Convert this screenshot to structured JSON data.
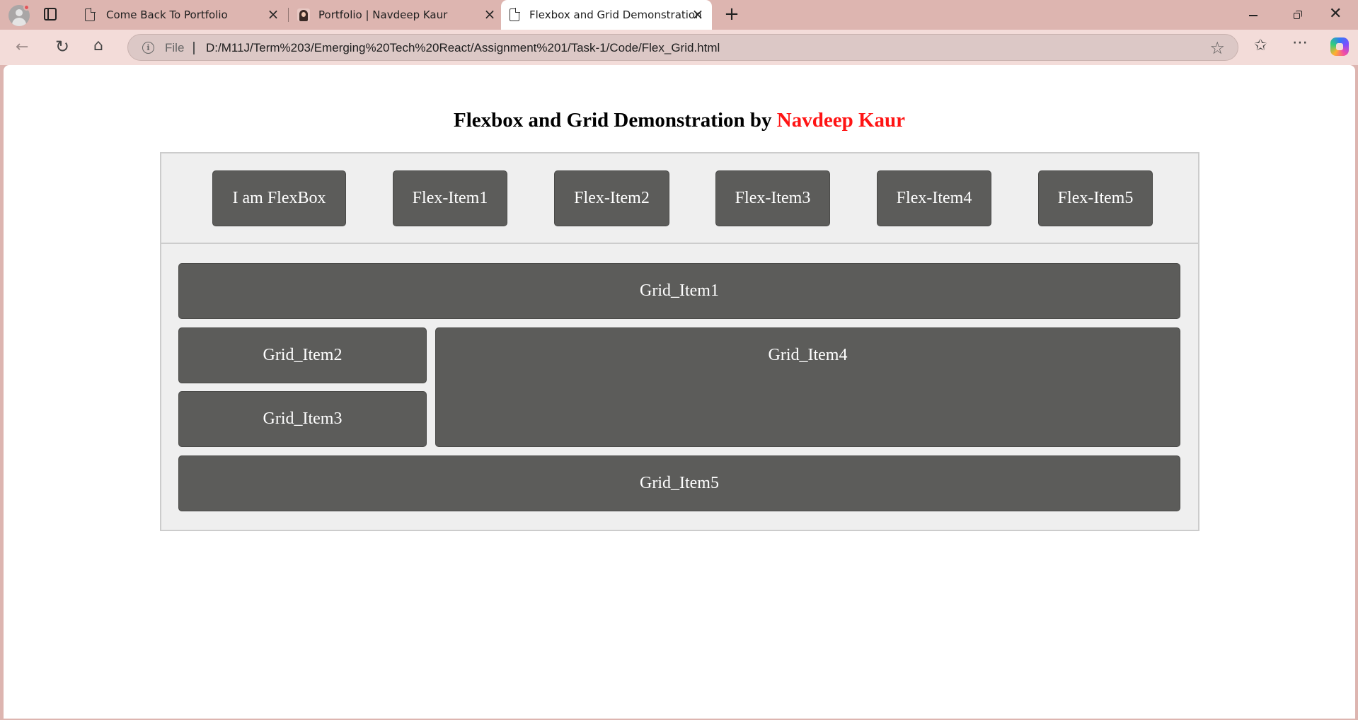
{
  "browser": {
    "tabs": [
      {
        "title": "Come Back To Portfolio"
      },
      {
        "title": "Portfolio | Navdeep Kaur"
      },
      {
        "title": "Flexbox and Grid Demonstration"
      }
    ],
    "address": {
      "scheme_label": "File",
      "url": "D:/M11J/Term%203/Emerging%20Tech%20React/Assignment%201/Task-1/Code/Flex_Grid.html"
    }
  },
  "page": {
    "heading_prefix": "Flexbox and Grid Demonstration by",
    "heading_name": "Navdeep Kaur",
    "flex_items": [
      "I am FlexBox",
      "Flex-Item1",
      "Flex-Item2",
      "Flex-Item3",
      "Flex-Item4",
      "Flex-Item5"
    ],
    "grid_items": [
      "Grid_Item1",
      "Grid_Item2",
      "Grid_Item3",
      "Grid_Item4",
      "Grid_Item5"
    ]
  },
  "colors": {
    "chrome": "#ddb5b0",
    "toolbar": "#f3dcd9",
    "item_bg": "#5c5c5a",
    "container_bg": "#efefef",
    "accent_name": "#ff1414"
  },
  "icons": [
    "profile-icon",
    "tab-actions-icon",
    "document-icon",
    "close-icon",
    "new-tab-icon",
    "back-icon",
    "reload-icon",
    "home-icon",
    "info-icon",
    "star-icon",
    "favorites-icon",
    "more-icon",
    "copilot-icon"
  ]
}
